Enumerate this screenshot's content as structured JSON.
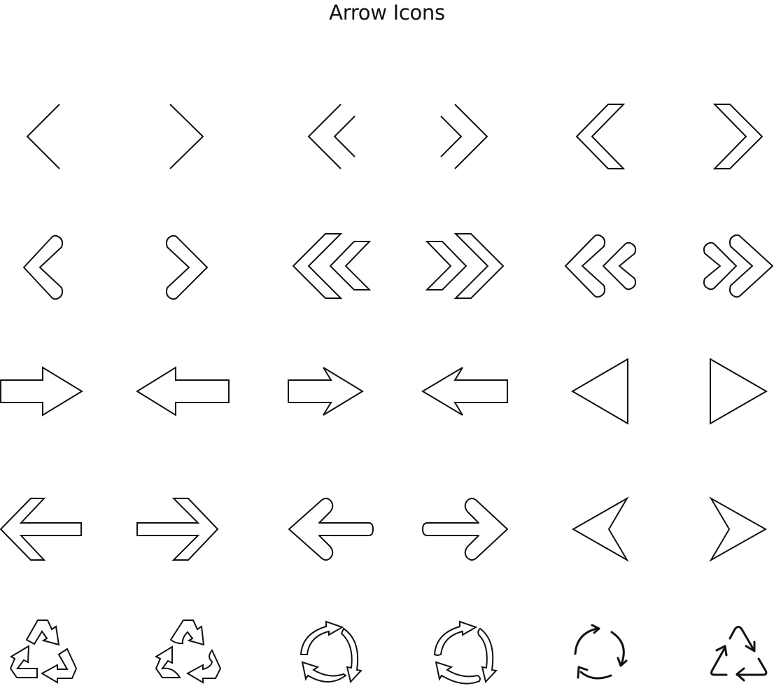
{
  "title": "Arrow Icons",
  "colors": {
    "stroke": "#111111",
    "background": "#ffffff"
  },
  "rows": [
    {
      "name": "thin-chevrons",
      "icons": [
        "chevron-left-thin-icon",
        "chevron-right-thin-icon",
        "double-chevron-left-thin-icon",
        "double-chevron-right-thin-icon",
        "chevron-left-outline-icon",
        "chevron-right-outline-icon"
      ]
    },
    {
      "name": "bold-chevrons",
      "icons": [
        "chevron-left-rounded-icon",
        "chevron-right-rounded-icon",
        "double-chevron-left-outline-icon",
        "double-chevron-right-outline-icon",
        "double-chevron-left-rounded-icon",
        "double-chevron-right-rounded-icon"
      ]
    },
    {
      "name": "block-arrows",
      "icons": [
        "block-arrow-right-icon",
        "block-arrow-left-icon",
        "notched-arrow-right-icon",
        "notched-arrow-left-icon",
        "triangle-left-icon",
        "triangle-right-icon"
      ]
    },
    {
      "name": "line-arrows",
      "icons": [
        "arrow-left-outline-icon",
        "arrow-right-outline-icon",
        "arrow-left-rounded-icon",
        "arrow-right-rounded-icon",
        "navigation-arrow-left-icon",
        "navigation-arrow-right-icon"
      ]
    },
    {
      "name": "cycle-icons",
      "icons": [
        "recycle-icon",
        "recycle-curved-icon",
        "refresh-circle-icon",
        "refresh-circle-curved-icon",
        "refresh-thin-icon",
        "recycle-triangle-thin-icon"
      ]
    }
  ]
}
